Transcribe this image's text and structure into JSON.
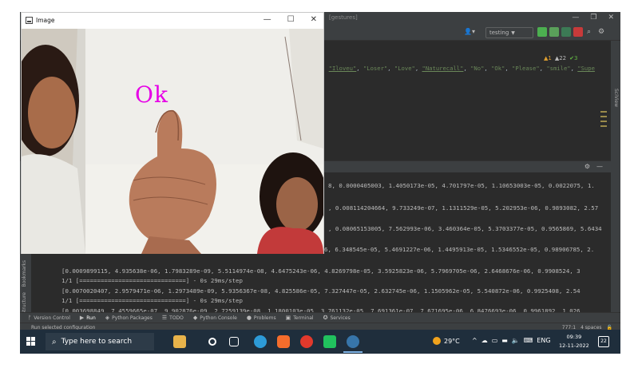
{
  "ide": {
    "title": "[gestures]",
    "toolbar": {
      "run_config": "testing"
    },
    "editor": {
      "code_prefix": ", ",
      "code_strings": [
        "Iloveu",
        "Loser",
        "Love",
        "Naturecall",
        "No",
        "Ok",
        "Please",
        "smile",
        "Supe"
      ],
      "inspection_warnings": "▲1",
      "inspection_weak": "▲22",
      "inspection_ok": "✔3"
    },
    "right_strip_label": "SciView",
    "left_gutter_labels": {
      "bookmarks": "Bookmarks",
      "structure": "Structure"
    },
    "run_output": [
      "8, 0.0000405003, 1.4050173e-05, 4.701797e-05, 1.10653003e-05, 0.0022075, 1.",
      ", 0.008114204664, 9.733249e-07, 1.1311529e-05, 5.202953e-06, 0.9893082, 2.57",
      ", 0.08065153005, 7.562993e-06, 3.460364e-05, 5.3703377e-05, 0.9565869, 5.6434",
      "6, 6.348545e-05, 5.4691227e-06, 1.4495913e-05, 1.5346552e-05, 0.98906785, 2.",
      "[0.0009899115, 4.935638e-06, 1.7983289e-09, 5.5114974e-08, 4.6475243e-06, 4.8269798e-05, 3.5925823e-06, 5.7969705e-06, 2.6468676e-06, 0.9908524, 3",
      "1/1 [==============================] - 0s 29ms/step",
      "[0.0070020407, 2.9579471e-06, 1.2973489e-09, 5.9356367e-08, 4.825586e-05, 7.327447e-05, 2.632745e-06, 1.1505962e-05, 5.540872e-06, 0.9925408, 2.54",
      "1/1 [==============================] - 0s 29ms/step",
      "[0.003698849, 7.4559665e-07, 9.902876e-09, 2.7259139e-08, 1.1800103e-05, 3.761132e-05, 7.691361e-07, 7.671695e-06, 6.8476693e-06, 0.9961892, 1.026",
      "1/1 [==============================] - 0s 27ms/step"
    ],
    "tool_tabs": [
      {
        "icon": "version-control-icon",
        "glyph": "ᚠ",
        "label": "Version Control"
      },
      {
        "icon": "run-icon",
        "glyph": "▶",
        "label": "Run"
      },
      {
        "icon": "python-packages-icon",
        "glyph": "◈",
        "label": "Python Packages"
      },
      {
        "icon": "todo-icon",
        "glyph": "☰",
        "label": "TODO"
      },
      {
        "icon": "python-console-icon",
        "glyph": "◆",
        "label": "Python Console"
      },
      {
        "icon": "problems-icon",
        "glyph": "●",
        "label": "Problems"
      },
      {
        "icon": "terminal-icon",
        "glyph": "▣",
        "label": "Terminal"
      },
      {
        "icon": "services-icon",
        "glyph": "✪",
        "label": "Services"
      }
    ],
    "status_left": "Run selected configuration",
    "status_position": "777:1",
    "status_indent": "4 spaces"
  },
  "image_window": {
    "title": "Image",
    "prediction_label": "Ok",
    "controls": {
      "minimize": "—",
      "maximize": "☐",
      "close": "✕"
    }
  },
  "taskbar": {
    "search_placeholder": "Type here to search",
    "weather_temp": "29°C",
    "language": "ENG",
    "time": "09:39",
    "date": "12-11-2022",
    "notification_count": "22"
  },
  "colors": {
    "prediction_label": "#e600e6",
    "ide_background": "#2b2b2b",
    "taskbar": "#1f2e3c"
  }
}
